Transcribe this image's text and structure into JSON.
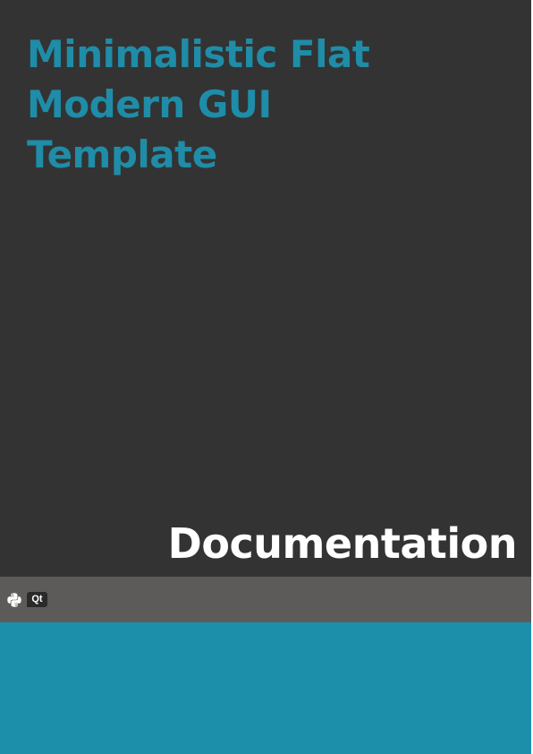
{
  "cover": {
    "title_lines": [
      "Minimalistic Flat",
      "Modern GUI",
      "Template"
    ],
    "subtitle": "Documentation",
    "logos": {
      "python": "python-logo-icon",
      "qt": "Qt"
    }
  },
  "colors": {
    "top_background": "#333333",
    "title": "#1f8ca8",
    "subtitle": "#ffffff",
    "logo_band": "#5c5b59",
    "bottom_band": "#1c8fab"
  }
}
